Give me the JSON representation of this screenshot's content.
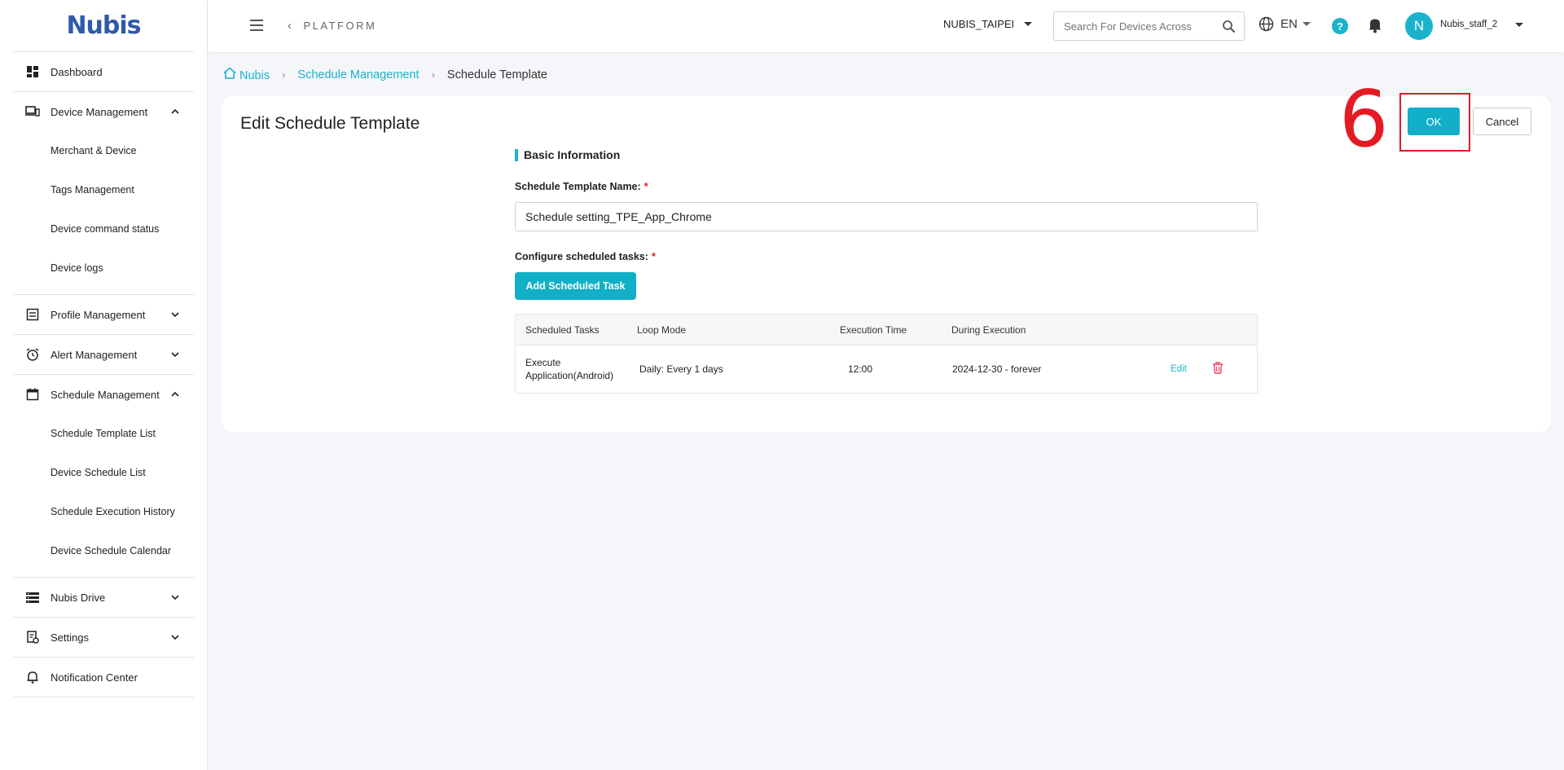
{
  "brand": {
    "logo_text": "Nubis"
  },
  "sidebar": {
    "items": [
      {
        "label": "Dashboard"
      },
      {
        "label": "Device Management",
        "expanded": true,
        "children": [
          "Merchant & Device",
          "Tags Management",
          "Device command status",
          "Device logs"
        ]
      },
      {
        "label": "Profile Management",
        "expanded": false
      },
      {
        "label": "Alert Management",
        "expanded": false
      },
      {
        "label": "Schedule Management",
        "expanded": true,
        "children": [
          "Schedule Template List",
          "Device Schedule List",
          "Schedule Execution History",
          "Device Schedule Calendar"
        ]
      },
      {
        "label": "Nubis Drive",
        "expanded": false
      },
      {
        "label": "Settings",
        "expanded": false
      },
      {
        "label": "Notification Center"
      }
    ]
  },
  "topbar": {
    "platform_label": "PLATFORM",
    "tenant": "NUBIS_TAIPEI",
    "search_placeholder": "Search For Devices Across",
    "language": "EN",
    "help": "?",
    "avatar_initial": "N",
    "username": "Nubis_staff_2"
  },
  "breadcrumb": {
    "home": "Nubis",
    "parent": "Schedule Management",
    "current": "Schedule Template"
  },
  "page": {
    "title": "Edit Schedule Template",
    "annotation_number": "6",
    "ok_label": "OK",
    "cancel_label": "Cancel"
  },
  "form": {
    "section_title": "Basic Information",
    "name_label": "Schedule Template Name:",
    "required_mark": "*",
    "name_value": "Schedule setting_TPE_App_Chrome",
    "tasks_label": "Configure scheduled tasks:",
    "add_task_label": "Add Scheduled Task"
  },
  "table": {
    "columns": [
      "Scheduled Tasks",
      "Loop Mode",
      "Execution Time",
      "During Execution"
    ],
    "rows": [
      {
        "task": "Execute Application(Android)",
        "loop_mode": "Daily: Every 1 days",
        "execution_time": "12:00",
        "during": "2024-12-30 - forever",
        "edit_label": "Edit"
      }
    ]
  },
  "colors": {
    "accent": "#12afc8",
    "annotation": "#e31b23",
    "brand": "#2f5aa8"
  }
}
